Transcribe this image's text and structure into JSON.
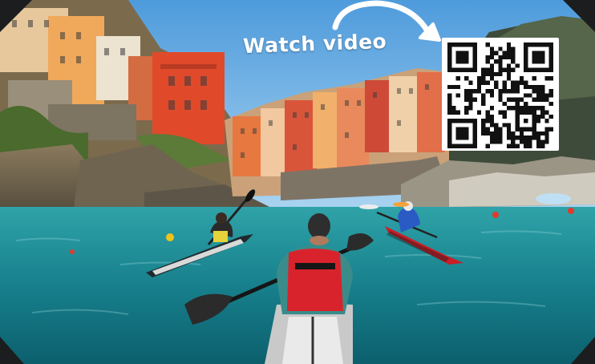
{
  "caption": {
    "text": "Watch video"
  },
  "qr": {
    "label": "qr-code",
    "modules": 25
  },
  "colors": {
    "sky": "#5fa8e0",
    "water": "#1e8a95",
    "building_red": "#e04a2b",
    "kayak_red": "#d3212c",
    "frame": "#1c1d1f"
  },
  "icons": [
    "arrow-icon",
    "qr-code"
  ]
}
